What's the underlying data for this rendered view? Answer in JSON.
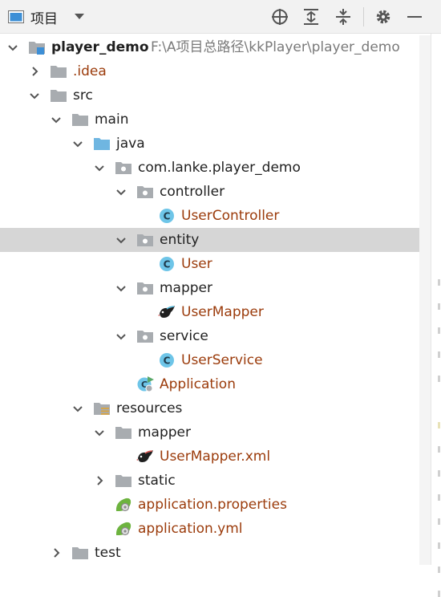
{
  "toolbar": {
    "view_label": "项目",
    "buttons": [
      "target-icon",
      "expand-all-icon",
      "collapse-all-icon",
      "gear-icon",
      "minimize-icon"
    ]
  },
  "tree": {
    "project_name": "player_demo",
    "project_path": "F:\\A项目总路径\\kkPlayer\\player_demo",
    "idea": ".idea",
    "src": "src",
    "main": "main",
    "java": "java",
    "package": "com.lanke.player_demo",
    "controller": "controller",
    "user_controller": "UserController",
    "entity": "entity",
    "user": "User",
    "mapper_pkg": "mapper",
    "user_mapper": "UserMapper",
    "service": "service",
    "user_service": "UserService",
    "application": "Application",
    "resources": "resources",
    "mapper_dir": "mapper",
    "user_mapper_xml": "UserMapper.xml",
    "static": "static",
    "app_properties": "application.properties",
    "app_yml": "application.yml",
    "test": "test"
  },
  "colors": {
    "selected_row": "#d6d6d6",
    "file_text": "#9b3b0b",
    "class_icon": "#6ec5e8",
    "folder": "#a8acb0",
    "source_folder": "#6fb6e1"
  }
}
